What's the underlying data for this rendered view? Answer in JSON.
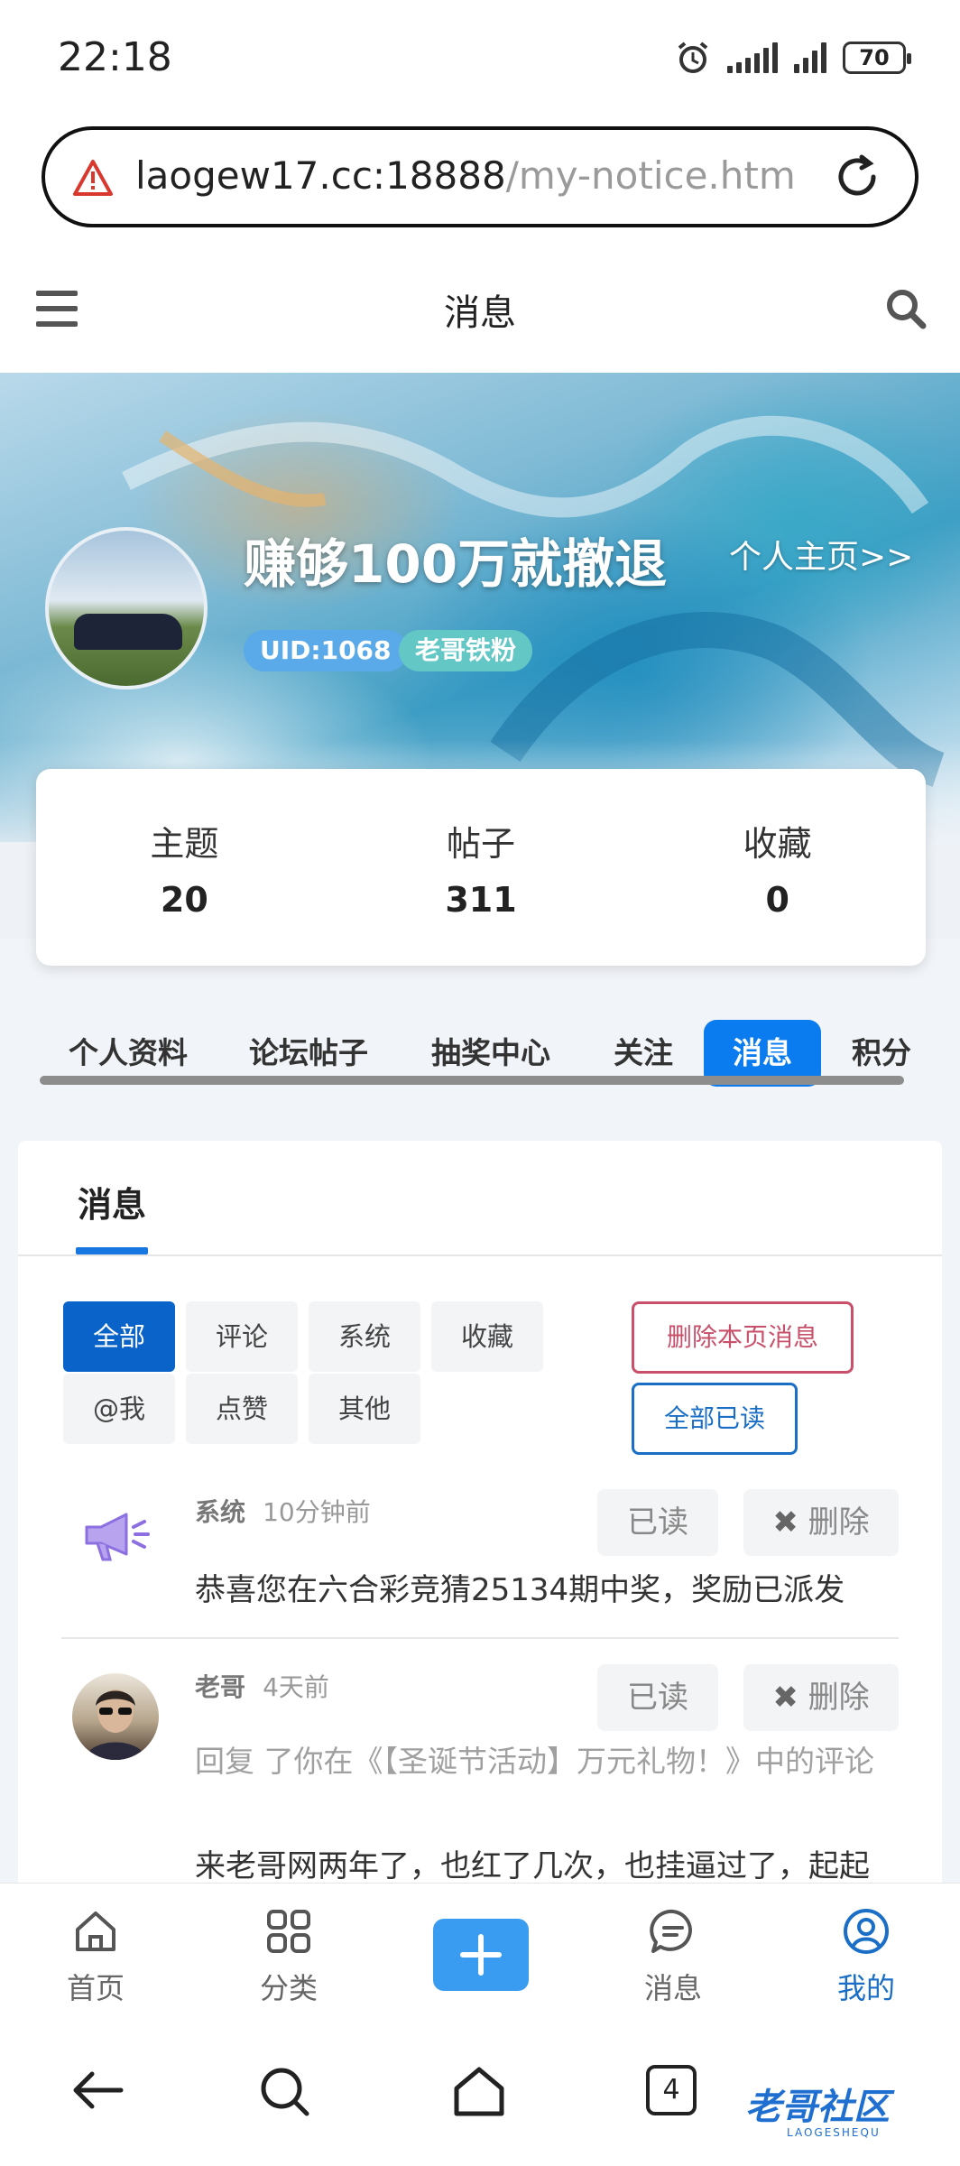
{
  "status_bar": {
    "time": "22:18",
    "battery": "70"
  },
  "browser": {
    "url_host": "laogew17.cc:18888",
    "url_path": "/my-notice.htm",
    "tab_count": "4"
  },
  "header": {
    "title": "消息"
  },
  "profile": {
    "username": "赚够100万就撤退",
    "profile_link": "个人主页>>",
    "uid_badge": "UID:1068",
    "rank_badge": "老哥铁粉"
  },
  "stats": [
    {
      "label": "主题",
      "value": "20"
    },
    {
      "label": "帖子",
      "value": "311"
    },
    {
      "label": "收藏",
      "value": "0"
    }
  ],
  "tabs": [
    "个人资料",
    "论坛帖子",
    "抽奖中心",
    "关注",
    "消息",
    "积分"
  ],
  "active_tab": "消息",
  "panel": {
    "title": "消息"
  },
  "filters": [
    "全部",
    "评论",
    "系统",
    "收藏",
    "@我",
    "点赞",
    "其他"
  ],
  "actions": {
    "delete_page": "删除本页消息",
    "read_all": "全部已读"
  },
  "messages": [
    {
      "sender": "系统",
      "time": "10分钟前",
      "icon": "megaphone-icon",
      "read_label": "已读",
      "delete_label": "删除",
      "content": "恭喜您在六合彩竞猜25134期中奖，奖励已派发"
    },
    {
      "sender": "老哥",
      "time": "4天前",
      "icon": "avatar",
      "read_label": "已读",
      "delete_label": "删除",
      "reply_prefix": "回复 了你在《【圣诞节活动】万元礼物！》中的评论",
      "content": "来老哥网两年了，也红了几次，也挂逼过了，起起"
    }
  ],
  "bottom_nav": [
    {
      "label": "首页",
      "icon": "home-icon"
    },
    {
      "label": "分类",
      "icon": "grid-icon"
    },
    {
      "label": "",
      "icon": "plus-icon"
    },
    {
      "label": "消息",
      "icon": "chat-icon"
    },
    {
      "label": "我的",
      "icon": "user-icon"
    }
  ],
  "watermark": {
    "text": "老哥社区",
    "sub": "LAOGESHEQU"
  },
  "colors": {
    "accent": "#0a7cf0",
    "danger": "#c8506a",
    "link": "#1a6ec6"
  }
}
